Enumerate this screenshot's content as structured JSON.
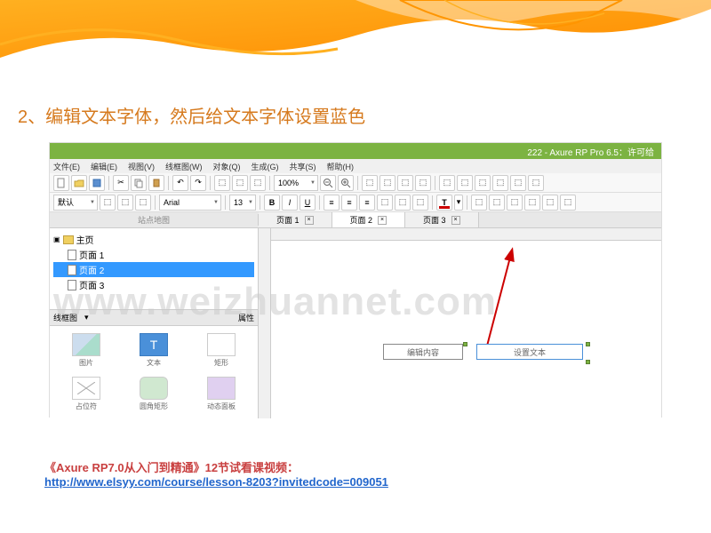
{
  "page": {
    "heading": "2、编辑文本字体，然后给文本字体设置蓝色"
  },
  "app": {
    "title": "222 - Axure RP Pro 6.5：许可给",
    "menus": [
      "文件(E)",
      "编辑(E)",
      "视图(V)",
      "线框图(W)",
      "对象(Q)",
      "生成(G)",
      "共享(S)",
      "帮助(H)"
    ],
    "zoom": "100%",
    "font_family_label": "默认",
    "font_name": "Arial",
    "font_size": "13",
    "sidebar_label": "站点地图"
  },
  "tabs": {
    "items": [
      "页面 1",
      "页面 2",
      "页面 3"
    ],
    "active_index": 1
  },
  "tree": {
    "root": "主页",
    "pages": [
      "页面 1",
      "页面 2",
      "页面 3"
    ],
    "selected_index": 1
  },
  "widgets_panel": {
    "tab": "线框图",
    "properties": "属性",
    "items": [
      {
        "label": "图片"
      },
      {
        "label": "文本"
      },
      {
        "label": "矩形"
      },
      {
        "label": "占位符"
      },
      {
        "label": "圆角矩形"
      },
      {
        "label": "动态面板"
      }
    ]
  },
  "canvas": {
    "field1": "编辑内容",
    "field2": "设置文本"
  },
  "watermark": "www.weizhuannet.com",
  "footer": {
    "title": "《Axure RP7.0从入门到精通》12节试看课视频：",
    "url": "http://www.elsyy.com/course/lesson-8203?invitedcode=009051"
  }
}
